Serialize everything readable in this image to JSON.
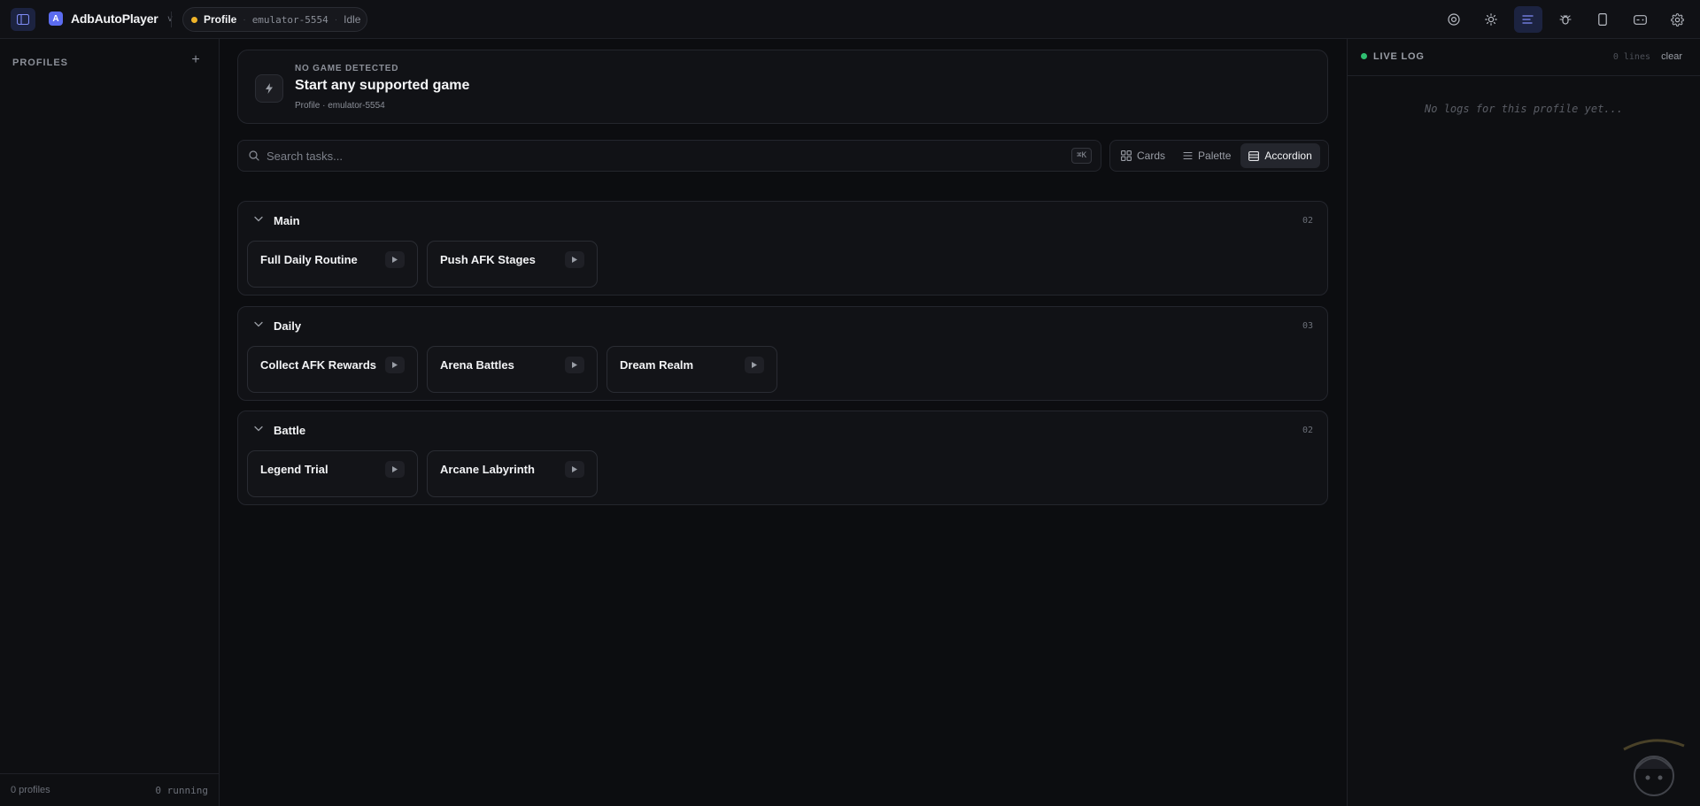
{
  "topbar": {
    "app_name": "AdbAutoPlayer",
    "brand_letter": "A",
    "caret": "v",
    "profile_label": "Profile",
    "pill_sep": "·",
    "emulator": "emulator-5554",
    "status": "Idle",
    "status_color": "#f0b429",
    "accent": "#5b6cf0",
    "icons": [
      "target-icon",
      "sun-icon",
      "log-lines-icon",
      "bug-icon",
      "phone-icon",
      "gamepad-icon",
      "gear-icon"
    ]
  },
  "sidebar": {
    "title": "PROFILES",
    "add_label": "+",
    "footer_profiles": "0 profiles",
    "footer_running": "0 running"
  },
  "game": {
    "tag": "NO GAME DETECTED",
    "title": "Start any supported game",
    "subtitle": "Profile · emulator-5554"
  },
  "search": {
    "placeholder": "Search tasks...",
    "shortcut": "⌘K"
  },
  "views": [
    {
      "label": "Cards",
      "active": false
    },
    {
      "label": "Palette",
      "active": false
    },
    {
      "label": "Accordion",
      "active": true
    }
  ],
  "groups": [
    {
      "title": "Main",
      "count": "02",
      "tasks": [
        "Full Daily Routine",
        "Push AFK Stages"
      ]
    },
    {
      "title": "Daily",
      "count": "03",
      "tasks": [
        "Collect AFK Rewards",
        "Arena Battles",
        "Dream Realm"
      ]
    },
    {
      "title": "Battle",
      "count": "02",
      "tasks": [
        "Legend Trial",
        "Arcane Labyrinth"
      ]
    }
  ],
  "log": {
    "title": "LIVE LOG",
    "lines": "0 lines",
    "clear_label": "clear",
    "empty_text": "No logs for this profile yet...",
    "live_color": "#2fbf71"
  }
}
